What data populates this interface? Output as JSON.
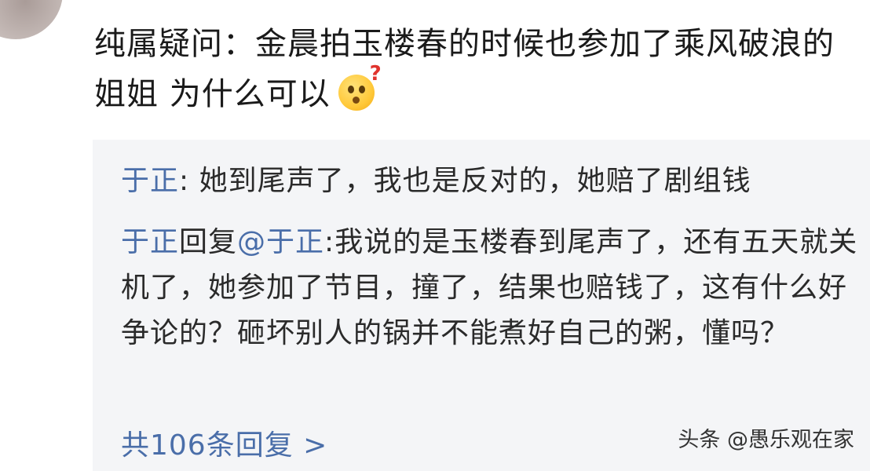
{
  "comment": {
    "text": "纯属疑问：金晨拍玉楼春的时候也参加了乘风破浪的姐姐 为什么可以",
    "emoji_icon": "thinking-question-emoji-icon"
  },
  "replies": [
    {
      "user": "于正",
      "separator": ": ",
      "text": "她到尾声了，我也是反对的，她赔了剧组钱"
    },
    {
      "user": "于正",
      "reply_word": "回复",
      "mention": "@于正",
      "separator": ":",
      "text": "我说的是玉楼春到尾声了，还有五天就关机了，她参加了节目，撞了，结果也赔钱了，这有什么好争论的？砸坏别人的锅并不能煮好自己的粥，懂吗？"
    }
  ],
  "more_replies": {
    "label": "共106条回复 >"
  },
  "watermark": {
    "text": "头条 @愚乐观在家"
  },
  "colors": {
    "username": "#4a6ea9",
    "reply_background": "#f4f5f7",
    "text": "#1a1a1a"
  }
}
